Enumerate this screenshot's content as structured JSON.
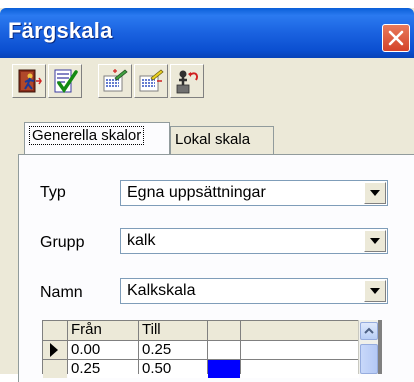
{
  "window": {
    "title": "Färgskala"
  },
  "toolbar": {
    "buttons": [
      {
        "icon": "exit-door-icon"
      },
      {
        "icon": "checklist-icon"
      },
      {
        "icon": "edit-swatch-icon"
      },
      {
        "icon": "edit-swatch-yellow-icon"
      },
      {
        "icon": "person-undo-icon"
      }
    ]
  },
  "tabs": [
    {
      "label": "Generella skalor",
      "active": true
    },
    {
      "label": "Lokal skala",
      "active": false
    }
  ],
  "form": {
    "typ": {
      "label": "Typ",
      "value": "Egna uppsättningar"
    },
    "grupp": {
      "label": "Grupp",
      "value": "kalk"
    },
    "namn": {
      "label": "Namn",
      "value": "Kalkskala"
    }
  },
  "grid": {
    "columns": [
      "Från",
      "Till"
    ],
    "rows": [
      {
        "from": "0.00",
        "to": "0.25",
        "color": "#0000ff"
      },
      {
        "from": "0.25",
        "to": "0.50",
        "color": "#0000ff"
      }
    ]
  }
}
